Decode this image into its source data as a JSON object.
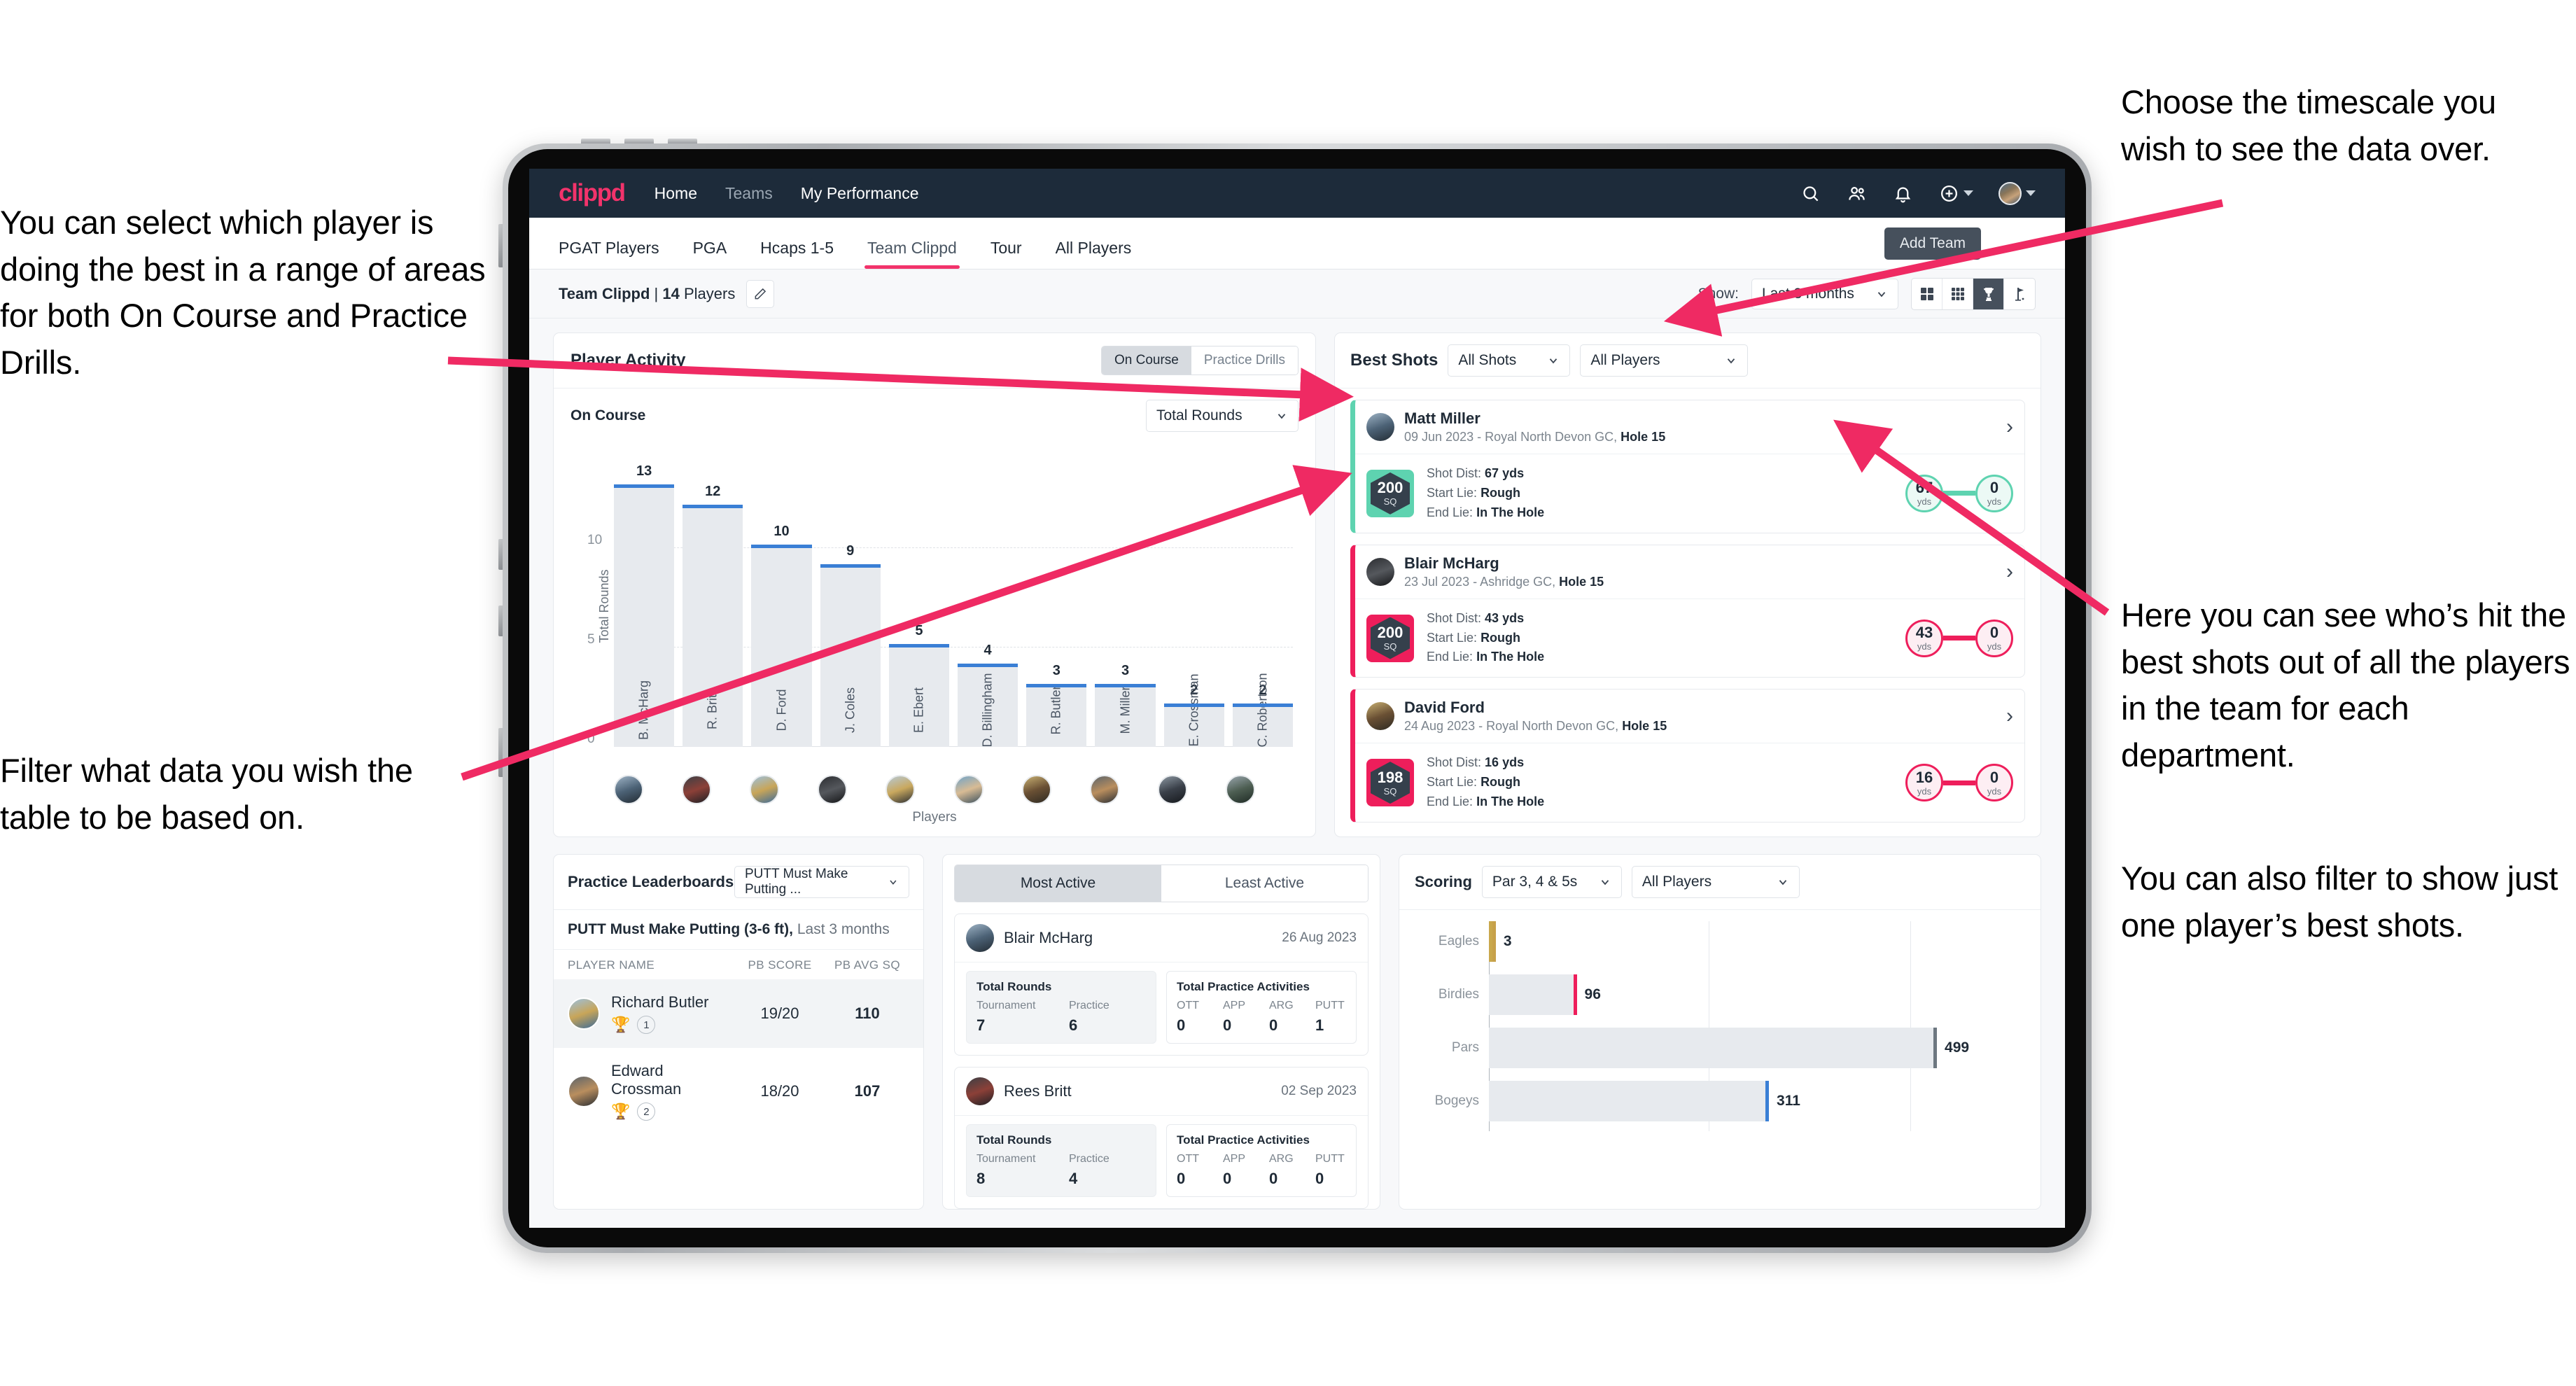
{
  "annotations": {
    "left_top": "You can select which player is doing the best in a range of areas for both On Course and Practice Drills.",
    "left_bottom": "Filter what data you wish the table to be based on.",
    "right_top": "Choose the timescale you wish to see the data over.",
    "right_middle": "Here you can see who’s hit the best shots out of all the players in the team for each department.",
    "right_bottom": "You can also filter to show just one player’s best shots."
  },
  "app": {
    "logo": "clippd",
    "nav_links": [
      {
        "label": "Home",
        "active": true
      },
      {
        "label": "Teams",
        "active": false
      },
      {
        "label": "My Performance",
        "active": true
      }
    ],
    "nav_icons": [
      "search-icon",
      "people-icon",
      "bell-icon",
      "plus-circle-icon",
      "avatar"
    ],
    "tabs": [
      {
        "label": "PGAT Players",
        "active": false
      },
      {
        "label": "PGA",
        "active": false
      },
      {
        "label": "Hcaps 1-5",
        "active": false
      },
      {
        "label": "Team Clippd",
        "active": true
      },
      {
        "label": "Tour",
        "active": false
      },
      {
        "label": "All Players",
        "active": false
      }
    ],
    "add_team_tooltip": "Add Team",
    "subbar": {
      "team_name": "Team Clippd",
      "separator": "|",
      "player_count": "14",
      "players_word": "Players",
      "edit_icon": "pencil-icon",
      "show_label": "Show:",
      "period_value": "Last 3 months",
      "view_icons": [
        "grid-4-icon",
        "grid-9-icon",
        "trophy-icon",
        "flag-icon"
      ],
      "active_view": "trophy-icon"
    }
  },
  "player_activity": {
    "title": "Player Activity",
    "segments": [
      {
        "label": "On Course",
        "active": true
      },
      {
        "label": "Practice Drills",
        "active": false
      }
    ],
    "sub_label": "On Course",
    "metric_select": "Total Rounds"
  },
  "best_shots": {
    "title": "Best Shots",
    "shot_filter": "All Shots",
    "player_filter": "All Players",
    "cards": [
      {
        "name": "Matt Miller",
        "meta_date": "09 Jun 2023 - Royal North Devon GC,",
        "meta_hole": "Hole 15",
        "sq": "200",
        "sq_unit": "SQ",
        "accent": "#5ed3b0",
        "shot_dist_label": "Shot Dist:",
        "shot_dist": "67 yds",
        "start_lie_label": "Start Lie:",
        "start_lie": "Rough",
        "end_lie_label": "End Lie:",
        "end_lie": "In The Hole",
        "from_value": "67",
        "from_unit": "yds",
        "to_value": "0",
        "to_unit": "yds"
      },
      {
        "name": "Blair McHarg",
        "meta_date": "23 Jul 2023 - Ashridge GC,",
        "meta_hole": "Hole 15",
        "sq": "200",
        "sq_unit": "SQ",
        "accent": "#ef २",
        "accent_hex": "#ee1e5b",
        "shot_dist_label": "Shot Dist:",
        "shot_dist": "43 yds",
        "start_lie_label": "Start Lie:",
        "start_lie": "Rough",
        "end_lie_label": "End Lie:",
        "end_lie": "In The Hole",
        "from_value": "43",
        "from_unit": "yds",
        "to_value": "0",
        "to_unit": "yds"
      },
      {
        "name": "David Ford",
        "meta_date": "24 Aug 2023 - Royal North Devon GC,",
        "meta_hole": "Hole 15",
        "sq": "198",
        "sq_unit": "SQ",
        "accent_hex": "#ee1e5b",
        "shot_dist_label": "Shot Dist:",
        "shot_dist": "16 yds",
        "start_lie_label": "Start Lie:",
        "start_lie": "Rough",
        "end_lie_label": "End Lie:",
        "end_lie": "In The Hole",
        "from_value": "16",
        "from_unit": "yds",
        "to_value": "0",
        "to_unit": "yds"
      }
    ]
  },
  "practice_leaderboards": {
    "title": "Practice Leaderboards",
    "drill_select": "PUTT Must Make Putting ...",
    "subtitle_bold": "PUTT Must Make Putting (3-6 ft),",
    "subtitle_rest": " Last 3 months",
    "columns": [
      "PLAYER NAME",
      "PB SCORE",
      "PB AVG SQ"
    ],
    "rows": [
      {
        "name": "Richard Butler",
        "rank": "1",
        "trophy": "gold",
        "pb_score": "19/20",
        "pb_avg_sq": "110",
        "highlight": true
      },
      {
        "name": "Edward Crossman",
        "rank": "2",
        "trophy": "silver",
        "pb_score": "18/20",
        "pb_avg_sq": "107",
        "highlight": false
      }
    ]
  },
  "activity": {
    "tabs": [
      {
        "label": "Most Active",
        "active": true
      },
      {
        "label": "Least Active",
        "active": false
      }
    ],
    "cards": [
      {
        "name": "Blair McHarg",
        "date": "26 Aug 2023",
        "rounds_title": "Total Rounds",
        "rounds_keys": [
          "Tournament",
          "Practice"
        ],
        "rounds_values": [
          "7",
          "6"
        ],
        "practice_title": "Total Practice Activities",
        "practice_keys": [
          "OTT",
          "APP",
          "ARG",
          "PUTT"
        ],
        "practice_values": [
          "0",
          "0",
          "0",
          "1"
        ]
      },
      {
        "name": "Rees Britt",
        "date": "02 Sep 2023",
        "rounds_title": "Total Rounds",
        "rounds_keys": [
          "Tournament",
          "Practice"
        ],
        "rounds_values": [
          "8",
          "4"
        ],
        "practice_title": "Total Practice Activities",
        "practice_keys": [
          "OTT",
          "APP",
          "ARG",
          "PUTT"
        ],
        "practice_values": [
          "0",
          "0",
          "0",
          "0"
        ]
      }
    ]
  },
  "scoring": {
    "title": "Scoring",
    "par_filter": "Par 3, 4 & 5s",
    "player_filter": "All Players"
  },
  "chart_data": [
    {
      "type": "bar",
      "title": "Player Activity — On Course",
      "xlabel": "Players",
      "ylabel": "Total Rounds",
      "ylim": [
        0,
        14
      ],
      "yticks": [
        0,
        5,
        10
      ],
      "grid": true,
      "bar_color": "#e7eaee",
      "cap_color": "#3a7fd5",
      "categories": [
        "B. McHarg",
        "R. Britt",
        "D. Ford",
        "J. Coles",
        "E. Ebert",
        "D. Billingham",
        "R. Butler",
        "M. Miller",
        "E. Crossman",
        "C. Robertson"
      ],
      "values": [
        13,
        12,
        10,
        9,
        5,
        4,
        3,
        3,
        2,
        2
      ]
    },
    {
      "type": "bar",
      "orientation": "horizontal",
      "title": "Scoring",
      "xlabel": "",
      "ylabel": "",
      "xlim": [
        0,
        600
      ],
      "grid": true,
      "categories": [
        "Eagles",
        "Birdies",
        "Pars",
        "Bogeys"
      ],
      "values": [
        3,
        96,
        499,
        311
      ],
      "cap_colors": [
        "#c7a14a",
        "#ee1e5b",
        "#6d7780",
        "#3a7fd5"
      ]
    }
  ]
}
